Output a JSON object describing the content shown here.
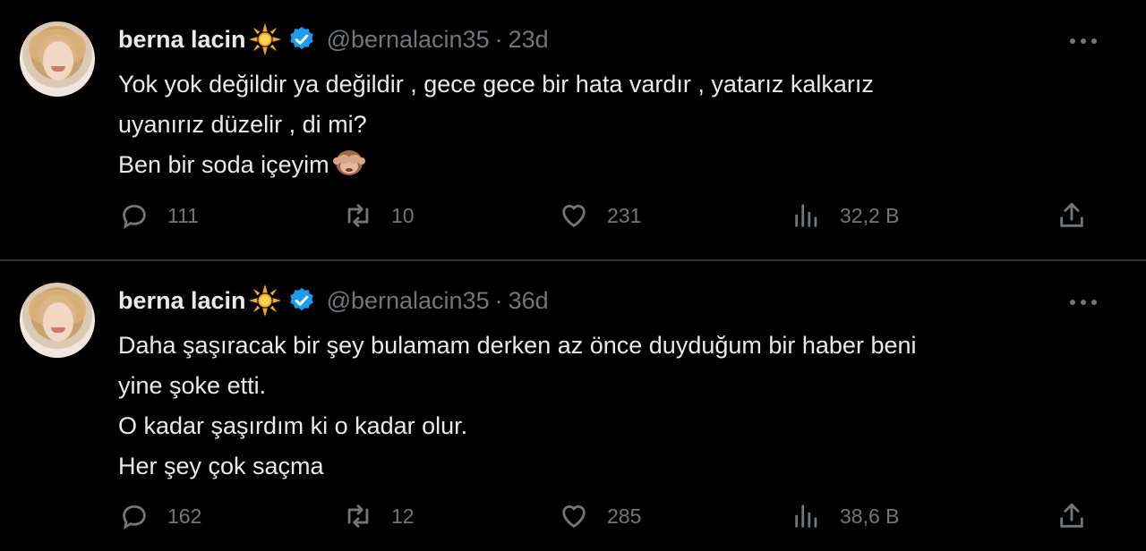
{
  "tweets": [
    {
      "author": {
        "name": "berna lacin",
        "handle": "@bernalacin35",
        "verified": true,
        "name_emoji": "sun-icon"
      },
      "time": "23d",
      "text_lines": [
        "Yok yok değildir ya değildir , gece gece bir hata vardır , yatarız kalkarız",
        "uyanırız düzelir , di mi?",
        "Ben bir soda içeyim"
      ],
      "trailing_emoji": "see-no-evil-monkey-icon",
      "stats": {
        "replies": "111",
        "reposts": "10",
        "likes": "231",
        "views": "32,2 B"
      }
    },
    {
      "author": {
        "name": "berna lacin",
        "handle": "@bernalacin35",
        "verified": true,
        "name_emoji": "sun-icon"
      },
      "time": "36d",
      "text_lines": [
        "Daha şaşıracak bir şey bulamam derken az önce duyduğum bir haber beni",
        "yine şoke etti.",
        "O kadar şaşırdım ki o kadar olur.",
        "Her şey çok saçma"
      ],
      "stats": {
        "replies": "162",
        "reposts": "12",
        "likes": "285",
        "views": "38,6 B"
      }
    }
  ],
  "colors": {
    "background": "#000000",
    "text": "#e7e9ea",
    "secondary": "#71767b",
    "divider": "#2f3336",
    "verified": "#1d9bf0"
  },
  "separator": "·"
}
